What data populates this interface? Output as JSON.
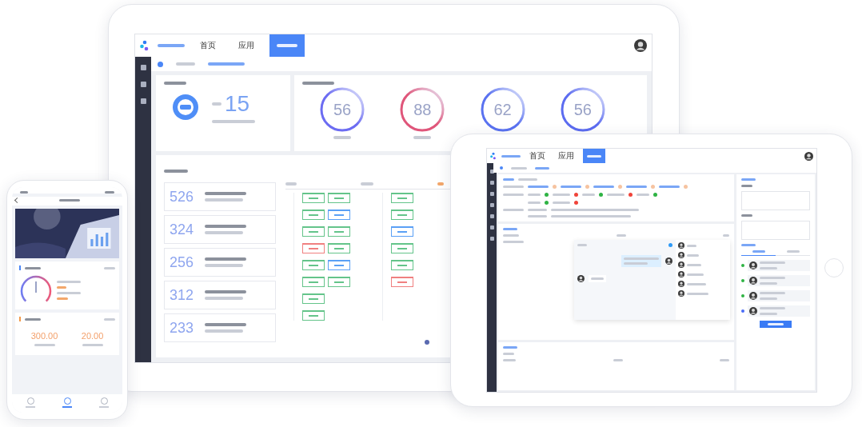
{
  "main_tablet": {
    "nav": [
      {
        "label": "首页",
        "selected": false
      },
      {
        "label": "应用",
        "selected": false
      },
      {
        "selected": true
      }
    ],
    "overview": {
      "value": "15"
    },
    "rings": [
      {
        "value": "56",
        "color": "#6c6cf2"
      },
      {
        "value": "88",
        "color": "#e0567a"
      },
      {
        "value": "62",
        "color": "#5a72f0"
      },
      {
        "value": "56",
        "color": "#5c6cf0"
      }
    ],
    "task_cards": [
      {
        "value": "526"
      },
      {
        "value": "324"
      },
      {
        "value": "256"
      },
      {
        "value": "312"
      },
      {
        "value": "233"
      }
    ],
    "schedule": [
      {
        "rows": [
          [
            {
              "kind": "ok"
            },
            {
              "kind": "ok"
            }
          ],
          [
            {
              "kind": "ok"
            },
            {
              "kind": "active"
            }
          ],
          [
            {
              "kind": "ok"
            },
            {
              "kind": "ok"
            }
          ],
          [
            {
              "kind": "alert"
            },
            {
              "kind": "ok"
            }
          ],
          [
            {
              "kind": "ok"
            },
            {
              "kind": "active"
            }
          ],
          [
            {
              "kind": "ok"
            },
            {
              "kind": "ok"
            }
          ],
          [
            {
              "kind": "ok"
            }
          ],
          [
            {
              "kind": "ok"
            }
          ]
        ]
      },
      {
        "rows": [
          [
            {
              "kind": "ok"
            }
          ],
          [
            {
              "kind": "ok"
            }
          ],
          [
            {
              "kind": "active"
            }
          ],
          [
            {
              "kind": "ok"
            }
          ],
          [
            {
              "kind": "ok"
            }
          ],
          [
            {
              "kind": "alert"
            }
          ]
        ]
      }
    ]
  },
  "second_tablet": {
    "nav": [
      {
        "label": "首页",
        "selected": false
      },
      {
        "label": "应用",
        "selected": false
      },
      {
        "selected": true
      }
    ],
    "status_dots": [
      {
        "color": "#2fb344"
      },
      {
        "color": "#f0443a"
      },
      {
        "color": "#2fb344"
      },
      {
        "color": "#f0443a"
      },
      {
        "color": "#2fb344"
      },
      {
        "color": "#2fb344"
      },
      {
        "color": "#f0443a"
      }
    ],
    "timeline": [
      {
        "color": "#2fb344"
      },
      {
        "color": "#2fb344"
      },
      {
        "color": "#2fb344"
      },
      {
        "color": "#4a6cf7"
      }
    ]
  },
  "phone": {
    "values": [
      "300.00",
      "20.00"
    ],
    "tabs": [
      {
        "selected": false
      },
      {
        "selected": true
      },
      {
        "selected": false
      }
    ]
  }
}
